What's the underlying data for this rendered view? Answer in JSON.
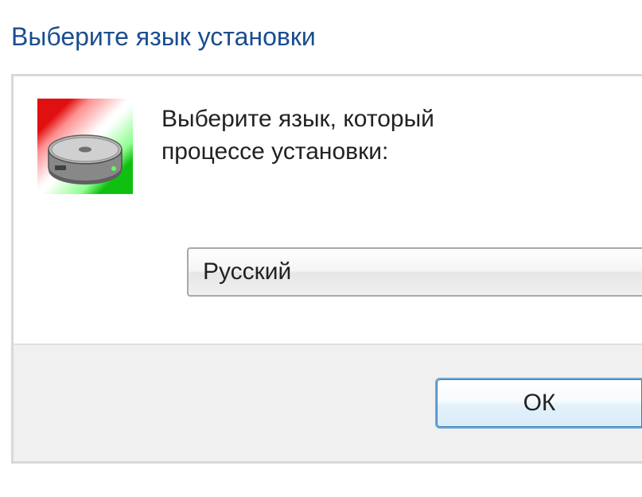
{
  "window": {
    "title": "Выберите язык установки"
  },
  "prompt": {
    "line1": "Выберите язык, который",
    "line2": "процессе установки:"
  },
  "dropdown": {
    "selected": "Русский"
  },
  "buttons": {
    "ok": "ОК"
  },
  "icon": {
    "name": "installer-disk"
  }
}
